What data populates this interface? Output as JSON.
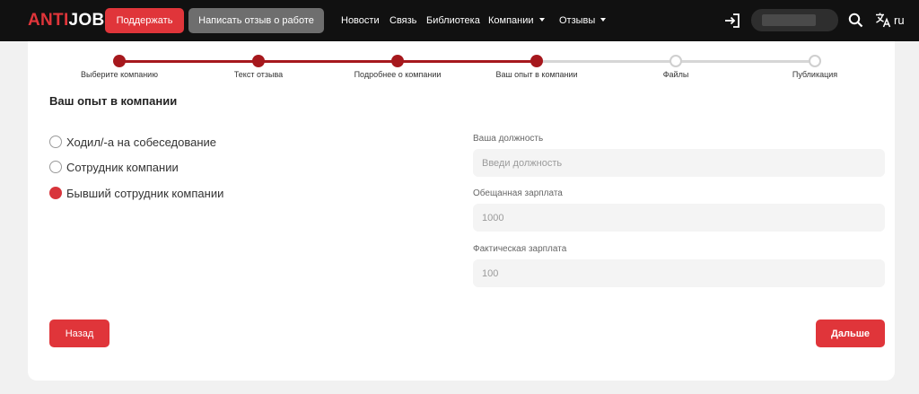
{
  "header": {
    "logo": {
      "anti": "ANTI",
      "job": "JOB"
    },
    "support_button": "Поддержать",
    "write_review_button": "Написать отзыв о работе",
    "nav": {
      "news": "Новости",
      "contact": "Связь",
      "library": "Библиотека",
      "companies": "Компании",
      "reviews": "Отзывы"
    },
    "language": "ru",
    "icons": [
      "login-icon",
      "search-icon",
      "translate-icon",
      "chevron-down-icon"
    ]
  },
  "stepper": {
    "steps": [
      {
        "label": "Выберите компанию",
        "state": "done"
      },
      {
        "label": "Текст отзыва",
        "state": "done"
      },
      {
        "label": "Подробнее о компании",
        "state": "done"
      },
      {
        "label": "Ваш опыт в компании",
        "state": "done"
      },
      {
        "label": "Файлы",
        "state": "todo"
      },
      {
        "label": "Публикация",
        "state": "todo"
      }
    ],
    "active_color": "#a6181d",
    "inactive_color": "#d6d6d6"
  },
  "form": {
    "title": "Ваш опыт в компании",
    "options": [
      {
        "label": "Ходил/-а на собеседование",
        "checked": false
      },
      {
        "label": "Сотрудник компании",
        "checked": false
      },
      {
        "label": "Бывший сотрудник компании",
        "checked": true
      }
    ],
    "position": {
      "label": "Ваша должность",
      "placeholder": "Введи должность",
      "value": ""
    },
    "promised_salary": {
      "label": "Обещанная зарплата",
      "placeholder": "1000",
      "value": ""
    },
    "actual_salary": {
      "label": "Фактическая зарплата",
      "placeholder": "100",
      "value": ""
    }
  },
  "actions": {
    "back": "Назад",
    "next": "Дальше"
  },
  "colors": {
    "accent": "#e0353a",
    "header_bg": "#111111"
  }
}
